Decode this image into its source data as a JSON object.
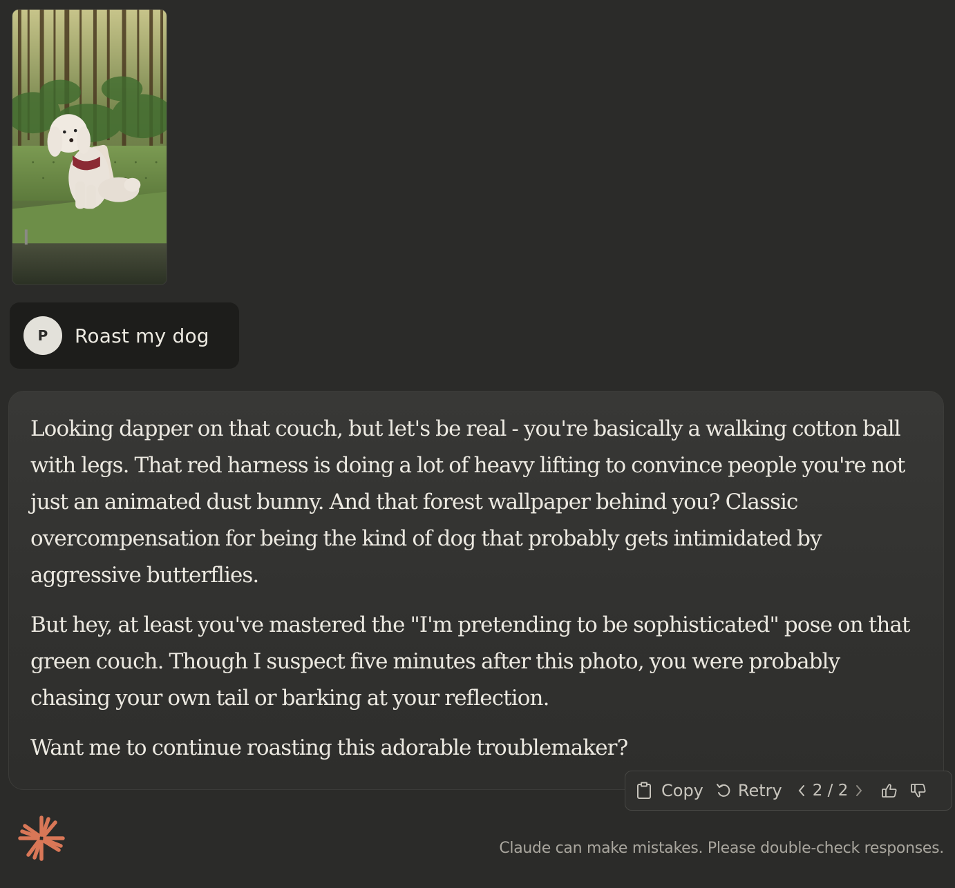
{
  "upload": {
    "image_description_icon": "dog-photo"
  },
  "user_message": {
    "avatar_initial": "P",
    "text": "Roast my dog"
  },
  "response": {
    "paragraphs": [
      "Looking dapper on that couch, but let's be real - you're basically a walking cotton ball with legs. That red harness is doing a lot of heavy lifting to convince people you're not just an animated dust bunny. And that forest wallpaper behind you? Classic overcompensation for being the kind of dog that probably gets intimidated by aggressive butterflies.",
      "But hey, at least you've mastered the \"I'm pretending to be sophisticated\" pose on that green couch. Though I suspect five minutes after this photo, you were probably chasing your own tail or barking at your reflection.",
      "Want me to continue roasting this adorable troublemaker?"
    ]
  },
  "actions": {
    "copy_label": "Copy",
    "retry_label": "Retry",
    "pager": "2 / 2",
    "icons": [
      "clipboard-icon",
      "retry-icon",
      "chevron-left-icon",
      "chevron-right-icon",
      "thumbs-up-icon",
      "thumbs-down-icon"
    ]
  },
  "footer": {
    "disclaimer": "Claude can make mistakes. Please double-check responses.",
    "logo_color": "#d97757"
  },
  "colors": {
    "background": "#2b2b29",
    "user_bubble": "#1d1d1b",
    "response_bg": "#363634",
    "text": "#ece9e1",
    "muted": "#a9a69e"
  }
}
